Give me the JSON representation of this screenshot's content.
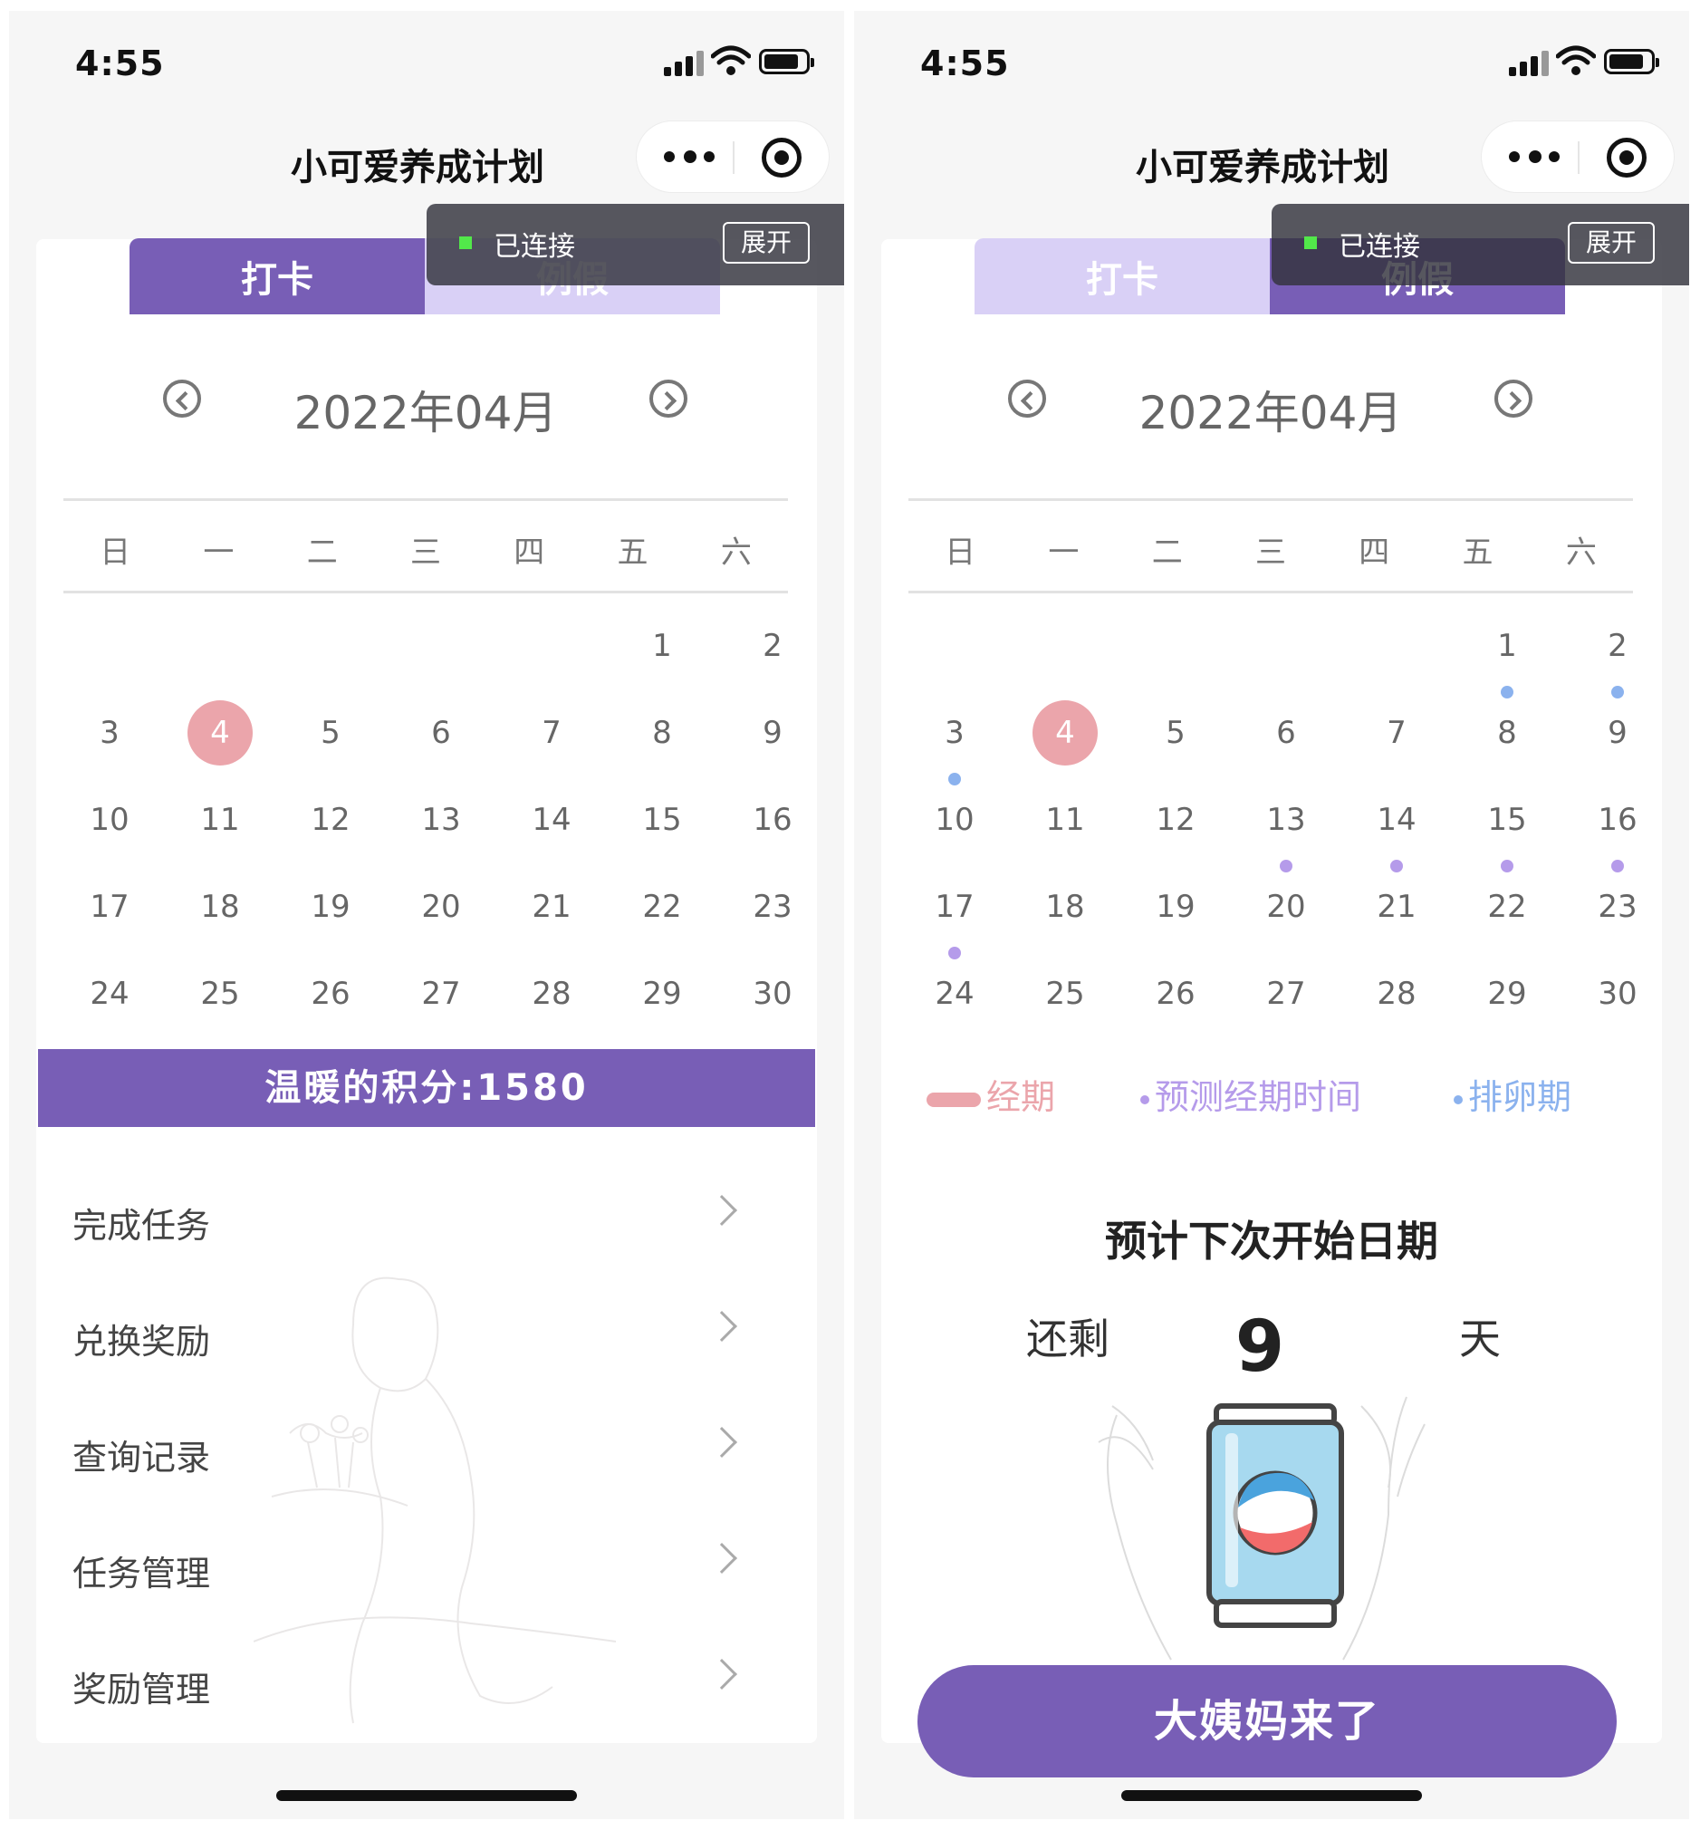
{
  "status": {
    "time": "4:55"
  },
  "nav": {
    "title": "小可爱养成计划"
  },
  "overlay": {
    "connected_label": "已连接",
    "expand_label": "展开"
  },
  "tabs": [
    {
      "label": "打卡"
    },
    {
      "label": "例假"
    }
  ],
  "calendar": {
    "month_label": "2022年04月",
    "weekdays": [
      "日",
      "一",
      "二",
      "三",
      "四",
      "五",
      "六"
    ],
    "days": [
      "1",
      "2",
      "3",
      "4",
      "5",
      "6",
      "7",
      "8",
      "9",
      "10",
      "11",
      "12",
      "13",
      "14",
      "15",
      "16",
      "17",
      "18",
      "19",
      "20",
      "21",
      "22",
      "23",
      "24",
      "25",
      "26",
      "27",
      "28",
      "29",
      "30"
    ],
    "first_weekday_index": 5,
    "today": 4,
    "ovulation_dots_below_days": [
      1,
      2,
      3
    ],
    "predicted_period_dots_below_days": [
      13,
      14,
      15,
      16,
      17
    ]
  },
  "left": {
    "points_bar": "温暖的积分:1580",
    "menu": [
      {
        "label": "完成任务"
      },
      {
        "label": "兑换奖励"
      },
      {
        "label": "查询记录"
      },
      {
        "label": "任务管理"
      },
      {
        "label": "奖励管理"
      }
    ]
  },
  "right": {
    "legend": {
      "period": "经期",
      "predicted": "预测经期时间",
      "ovulation": "排卵期"
    },
    "next_title": "预计下次开始日期",
    "remain_prefix": "还剩",
    "remain_days": "9",
    "remain_suffix": "天",
    "cta": "大姨妈来了"
  },
  "colors": {
    "primary": "#785eb6",
    "tab_inactive": "#d9d0f6",
    "today": "#eba5ab",
    "ovulation": "#8bb2ee",
    "predicted": "#b59bea"
  }
}
